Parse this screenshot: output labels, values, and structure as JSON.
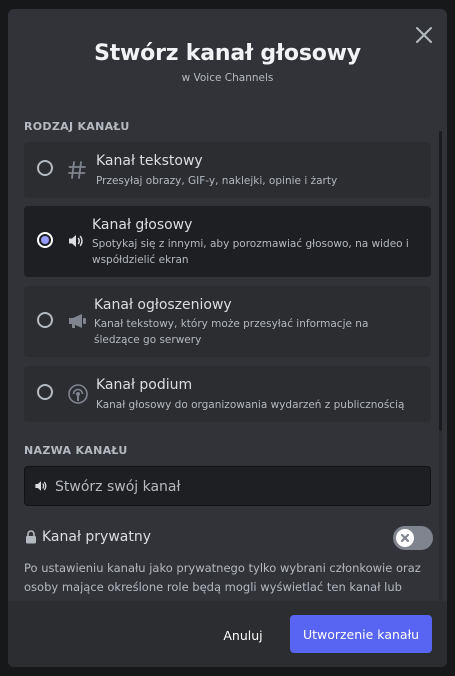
{
  "modal": {
    "title": "Stwórz kanał głosowy",
    "subtitle": "w Voice Channels",
    "close_icon": "close-icon"
  },
  "channel_type": {
    "section_label": "RODZAJ KANAŁU",
    "selected": "voice",
    "options": [
      {
        "id": "text",
        "icon": "hash-icon",
        "title": "Kanał tekstowy",
        "description": "Przesyłaj obrazy, GIF-y, naklejki, opinie i żarty"
      },
      {
        "id": "voice",
        "icon": "speaker-icon",
        "title": "Kanał głosowy",
        "description": "Spotykaj się z innymi, aby porozmawiać głosowo, na wideo i współdzielić ekran"
      },
      {
        "id": "announcement",
        "icon": "megaphone-icon",
        "title": "Kanał ogłoszeniowy",
        "description": "Kanał tekstowy, który może przesyłać informacje na śledzące go serwery"
      },
      {
        "id": "stage",
        "icon": "stage-icon",
        "title": "Kanał podium",
        "description": "Kanał głosowy do organizowania wydarzeń z publicznością"
      }
    ]
  },
  "channel_name": {
    "section_label": "NAZWA KANAŁU",
    "value": "",
    "placeholder": "Stwórz swój kanał"
  },
  "private": {
    "label": "Kanał prywatny",
    "enabled": false,
    "description": "Po ustawieniu kanału jako prywatnego tylko wybrani członkowie oraz osoby mające określone role będą mogli wyświetlać ten kanał lub"
  },
  "footer": {
    "cancel_label": "Anuluj",
    "create_label": "Utworzenie kanału"
  },
  "colors": {
    "brand": "#5865f2",
    "radio_selected": "#949cf7",
    "modal_bg": "#313338"
  }
}
